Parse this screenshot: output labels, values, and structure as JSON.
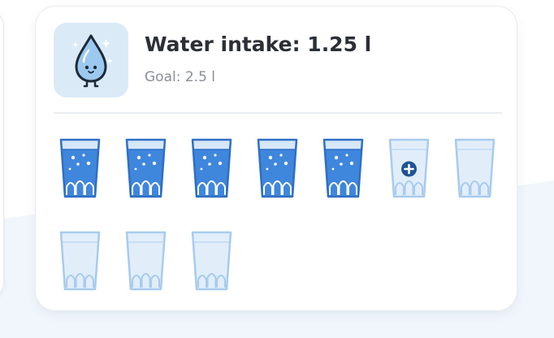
{
  "background": {
    "page_color": "#ffffff",
    "wave_color": "#f1f6fc"
  },
  "header": {
    "icon": "water-drop-mascot-icon",
    "title": "Water intake: 1.25 l",
    "goal": "Goal: 2.5 l"
  },
  "colors": {
    "icon_bg": "#dbeaf7",
    "water_fill": "#3f86dd",
    "water_outline": "#2f6fc4",
    "empty_fill": "#e1eefa",
    "empty_outline": "#a8cbee",
    "add_button": "#1f5494"
  },
  "glasses": [
    {
      "state": "filled"
    },
    {
      "state": "filled"
    },
    {
      "state": "filled"
    },
    {
      "state": "filled"
    },
    {
      "state": "filled"
    },
    {
      "state": "add",
      "icon": "plus-circle-icon"
    },
    {
      "state": "empty"
    },
    {
      "state": "empty"
    },
    {
      "state": "empty"
    },
    {
      "state": "empty"
    }
  ]
}
